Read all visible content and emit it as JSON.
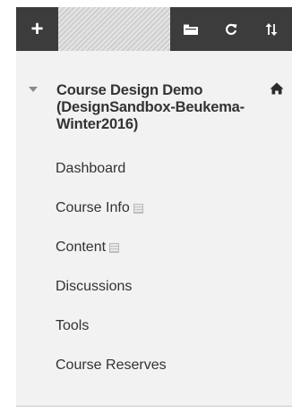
{
  "toolbar": {
    "add_icon": "plus-icon",
    "add_glyph": "+",
    "folder_icon": "folder-icon",
    "refresh_icon": "refresh-icon",
    "sort_icon": "sort-icon"
  },
  "course": {
    "title": "Course Design Demo (DesignSandbox-Beukema-Winter2016)",
    "expanded": true,
    "home_icon": "home-icon"
  },
  "menu": {
    "items": [
      {
        "label": "Dashboard",
        "hidden": false
      },
      {
        "label": "Course Info",
        "hidden": true
      },
      {
        "label": "Content",
        "hidden": true
      },
      {
        "label": "Discussions",
        "hidden": false
      },
      {
        "label": "Tools",
        "hidden": false
      },
      {
        "label": "Course Reserves",
        "hidden": false
      }
    ]
  },
  "colors": {
    "toolbar_bg": "#3c3c3c",
    "panel_bg": "#f2f2f2",
    "text": "#333333",
    "caret": "#8a8a8a"
  }
}
